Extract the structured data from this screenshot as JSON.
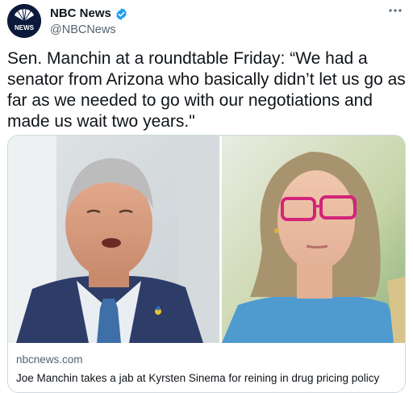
{
  "author": {
    "display_name": "NBC News",
    "handle": "@NBCNews",
    "avatar_icon": "nbc-news-logo",
    "avatar_text": "NEWS",
    "verified_icon": "verified-badge-icon",
    "verified_color": "#1d9bf0"
  },
  "more_icon": "more-options-icon",
  "tweet": {
    "text": "Sen. Manchin at a roundtable Friday: “We had a senator from Arizona who basically didn’t let us go as far as we needed to go with our negotiations and made us wait two years.\""
  },
  "card": {
    "domain": "nbcnews.com",
    "title": "Joe Manchin takes a jab at Kyrsten Sinema for reining in drug pricing policy"
  }
}
